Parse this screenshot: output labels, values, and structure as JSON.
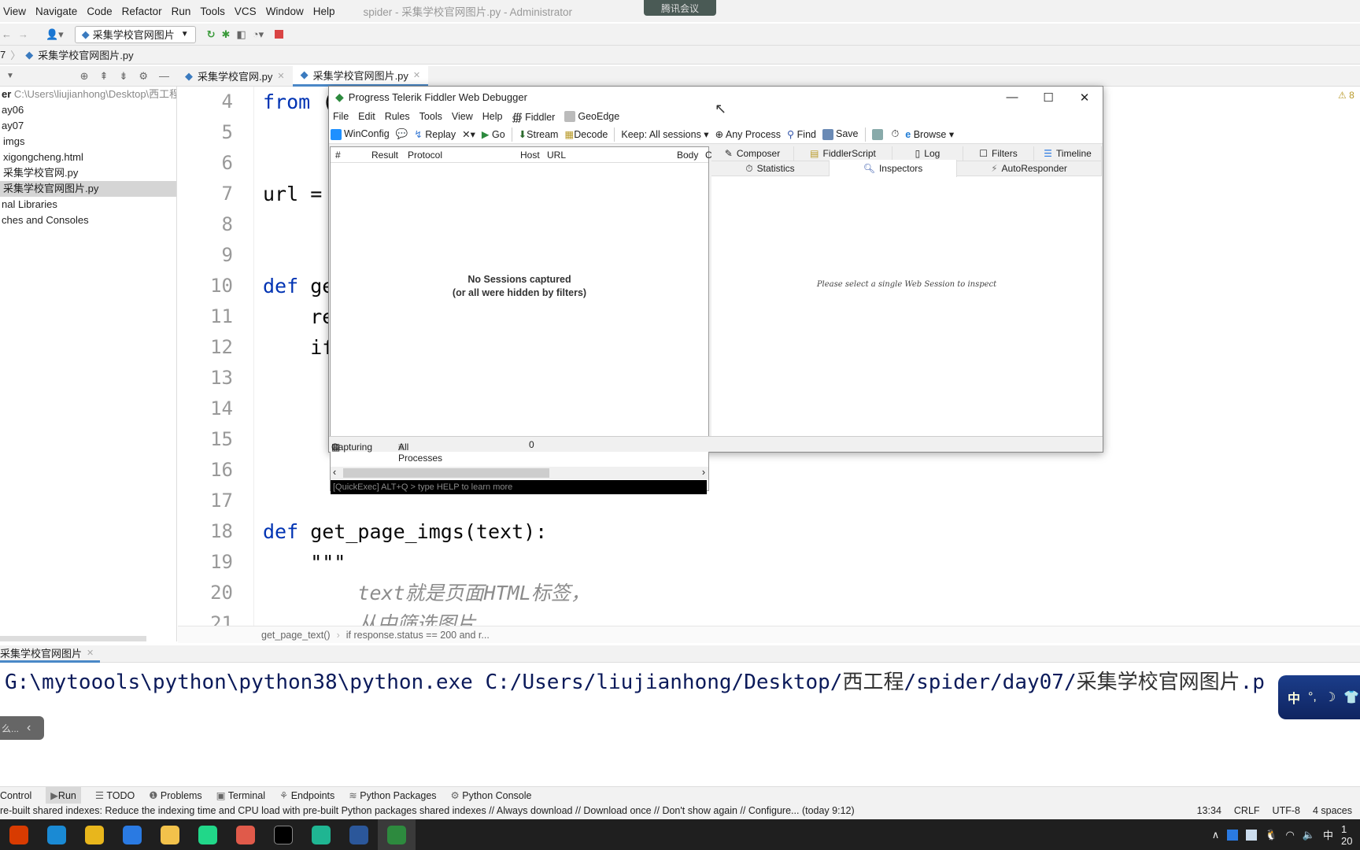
{
  "ide": {
    "menu": [
      "View",
      "Navigate",
      "Code",
      "Refactor",
      "Run",
      "Tools",
      "VCS",
      "Window",
      "Help"
    ],
    "window_title": "spider - 采集学校官网图片.py - Administrator",
    "meeting_badge": "腾讯会议",
    "run_config": "采集学校官网图片",
    "breadcrumb": [
      "7",
      "采集学校官网图片.py"
    ],
    "tabs": [
      {
        "label": "采集学校官网.py"
      },
      {
        "label": "采集学校官网图片.py",
        "active": true
      }
    ],
    "project_root_label": "er",
    "project_root_path": "C:\\Users\\liujianhong\\Desktop\\西工程",
    "project_items": [
      "ay06",
      "ay07",
      "imgs",
      "xigongcheng.html",
      "采集学校官网.py",
      "采集学校官网图片.py",
      "nal Libraries",
      "ches and Consoles"
    ],
    "selected_item": "采集学校官网图片.py",
    "code_lines": [
      {
        "n": "4",
        "kw": "from",
        "rest": " ("
      },
      {
        "n": "5",
        "kw": "",
        "rest": ""
      },
      {
        "n": "6",
        "kw": "",
        "rest": ""
      },
      {
        "n": "7",
        "kw": "",
        "rest": "url ="
      },
      {
        "n": "8",
        "kw": "",
        "rest": ""
      },
      {
        "n": "9",
        "kw": "",
        "rest": ""
      },
      {
        "n": "10",
        "kw": "def",
        "rest": " ge"
      },
      {
        "n": "11",
        "kw": "",
        "rest": "    re"
      },
      {
        "n": "12",
        "kw": "",
        "rest": "    if"
      },
      {
        "n": "13",
        "kw": "",
        "rest": ""
      },
      {
        "n": "14",
        "kw": "",
        "rest": ""
      },
      {
        "n": "15",
        "kw": "",
        "rest": ""
      },
      {
        "n": "16",
        "kw": "",
        "rest": ""
      },
      {
        "n": "17",
        "kw": "",
        "rest": ""
      },
      {
        "n": "18",
        "kw": "def",
        "rest": " get_page_imgs(text):"
      },
      {
        "n": "19",
        "kw": "",
        "rest": "    \"\"\""
      },
      {
        "n": "20",
        "kw": "",
        "rest": "        text就是页面HTML标签，",
        "doc": true
      },
      {
        "n": "21",
        "kw": "",
        "rest": "        从中筛选图片",
        "doc": true
      }
    ],
    "warning_count": "8",
    "editor_breadcrumb": [
      "get_page_text()",
      "if response.status == 200 and r..."
    ],
    "run_tab": "采集学校官网图片",
    "console_ascii": "G:\\mytoools\\python\\python38\\python.exe C:/Users/liujianhong/Desktop/",
    "console_parts": [
      "西工程",
      "/spider/day07/",
      "采集学校官网图片",
      ".p"
    ],
    "popup_text": "么...",
    "ime_text": "中",
    "tool_windows": [
      "Control",
      "Run",
      "TODO",
      "Problems",
      "Terminal",
      "Endpoints",
      "Python Packages",
      "Python Console"
    ],
    "active_tool_window": "Run",
    "status_message": "re-built shared indexes: Reduce the indexing time and CPU load with pre-built Python packages shared indexes // Always download // Download once // Don't show again // Configure... (today 9:12)",
    "status_right": [
      "13:34",
      "CRLF",
      "UTF-8",
      "4 spaces"
    ],
    "tray_ime": "中",
    "taskbar_apps": [
      "office-icon",
      "edge-icon",
      "chrome-icon",
      "lanxin-icon",
      "explorer-icon",
      "pycharm-icon",
      "app-icon",
      "terminal-icon",
      "notes-icon",
      "word-icon",
      "fiddler-icon"
    ]
  },
  "fiddler": {
    "title": "Progress Telerik Fiddler Web Debugger",
    "menu": [
      "File",
      "Edit",
      "Rules",
      "Tools",
      "View",
      "Help",
      "Fiddler",
      "GeoEdge"
    ],
    "toolbar": {
      "winconfig": "WinConfig",
      "replay": "Replay",
      "go": "Go",
      "stream": "Stream",
      "decode": "Decode",
      "keep": "Keep: All sessions",
      "process": "Any Process",
      "find": "Find",
      "save": "Save",
      "browse": "Browse"
    },
    "columns": [
      "#",
      "Result",
      "Protocol",
      "Host",
      "URL",
      "Body",
      "C"
    ],
    "empty_line1": "No Sessions captured",
    "empty_line2": "(or all were hidden by filters)",
    "quickexec": "[QuickExec] ALT+Q > type HELP to learn more",
    "tabs_row1": [
      "Composer",
      "FiddlerScript",
      "Log",
      "Filters",
      "Timeline"
    ],
    "tabs_row2": [
      "Statistics",
      "Inspectors",
      "AutoResponder"
    ],
    "active_tab": "Inspectors",
    "inspect_hint": "Please select a single Web Session to inspect",
    "status": {
      "capturing": "Capturing",
      "processes": "All Processes",
      "count": "0"
    }
  }
}
